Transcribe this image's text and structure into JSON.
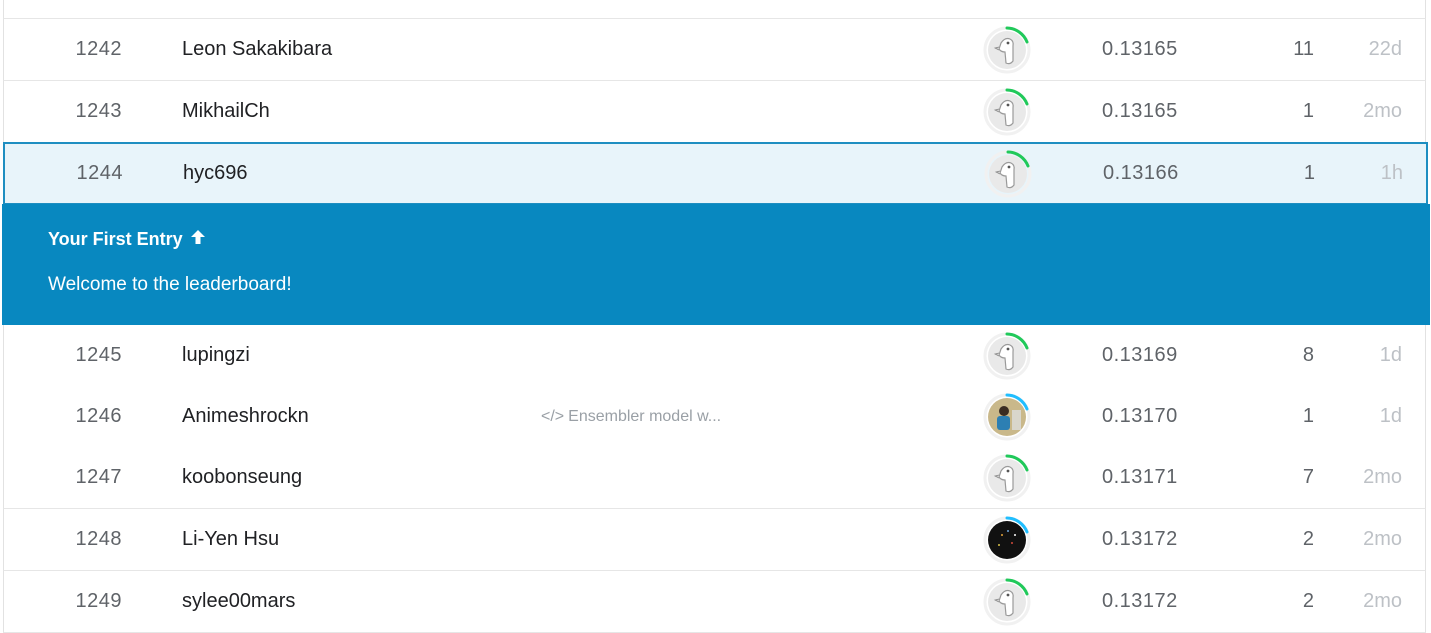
{
  "rows_before": [
    {
      "rank": "1242",
      "name": "Leon Sakakibara",
      "note": "",
      "score": "0.13165",
      "entries": "11",
      "last": "22d",
      "avatar": "default-goose-icon"
    },
    {
      "rank": "1243",
      "name": "MikhailCh",
      "note": "",
      "score": "0.13165",
      "entries": "1",
      "last": "2mo",
      "avatar": "default-goose-icon"
    }
  ],
  "selected_row": {
    "rank": "1244",
    "name": "hyc696",
    "note": "",
    "score": "0.13166",
    "entries": "1",
    "last": "1h",
    "avatar": "default-goose-icon"
  },
  "banner": {
    "title": "Your First Entry",
    "subtitle": "Welcome to the leaderboard!",
    "icon": "arrow-up-icon"
  },
  "rows_after": [
    {
      "rank": "1245",
      "name": "lupingzi",
      "note": "",
      "score": "0.13169",
      "entries": "8",
      "last": "1d",
      "avatar": "default-goose-icon"
    },
    {
      "rank": "1246",
      "name": "Animeshrockn",
      "note": "Ensembler model w...",
      "score": "0.13170",
      "entries": "1",
      "last": "1d",
      "avatar": "photo-avatar"
    },
    {
      "rank": "1247",
      "name": "koobonseung",
      "note": "",
      "score": "0.13171",
      "entries": "7",
      "last": "2mo",
      "avatar": "default-goose-icon"
    },
    {
      "rank": "1248",
      "name": "Li-Yen Hsu",
      "note": "",
      "score": "0.13172",
      "entries": "2",
      "last": "2mo",
      "avatar": "dark-photo-avatar"
    },
    {
      "rank": "1249",
      "name": "sylee00mars",
      "note": "",
      "score": "0.13172",
      "entries": "2",
      "last": "2mo",
      "avatar": "default-goose-icon"
    }
  ],
  "colors": {
    "accent": "#0888c0",
    "selected_bg": "#e8f4fa",
    "ring_green": "#20beff",
    "tier_green": "#20c95a",
    "tier_blue": "#20beff"
  }
}
